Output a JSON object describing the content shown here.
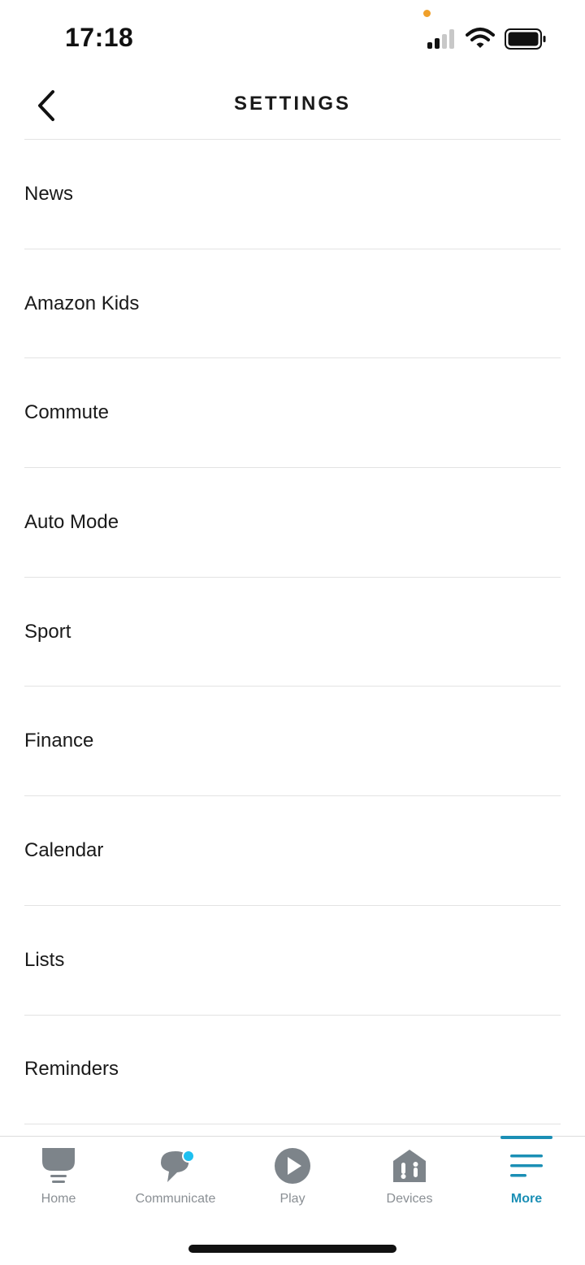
{
  "status_bar": {
    "time": "17:18",
    "icons": [
      "signal-icon",
      "wifi-icon",
      "battery-icon"
    ],
    "privacy_dot_color": "#f0a02a"
  },
  "header": {
    "title": "SETTINGS",
    "back_icon": "chevron-left-icon"
  },
  "settings": {
    "items": [
      {
        "label": "News"
      },
      {
        "label": "Amazon Kids"
      },
      {
        "label": "Commute"
      },
      {
        "label": "Auto Mode"
      },
      {
        "label": "Sport"
      },
      {
        "label": "Finance"
      },
      {
        "label": "Calendar"
      },
      {
        "label": "Lists"
      },
      {
        "label": "Reminders"
      }
    ]
  },
  "nav": {
    "items": [
      {
        "label": "Home",
        "icon": "home-icon"
      },
      {
        "label": "Communicate",
        "icon": "communicate-icon"
      },
      {
        "label": "Play",
        "icon": "play-icon"
      },
      {
        "label": "Devices",
        "icon": "devices-icon"
      },
      {
        "label": "More",
        "icon": "more-icon"
      }
    ],
    "active": "More"
  },
  "colors": {
    "accent": "#1b8fb5",
    "communicate_dot": "#1ec0f0",
    "icon_gray": "#7d848a",
    "divider": "#e3e3e3"
  }
}
